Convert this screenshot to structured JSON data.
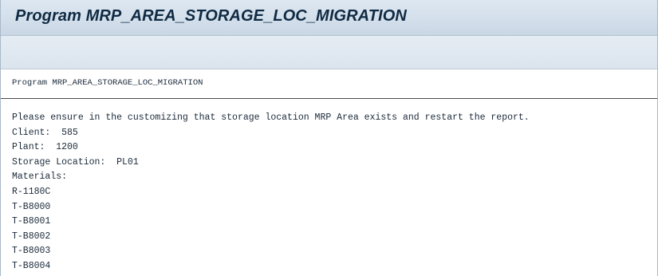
{
  "window": {
    "title": "Program MRP_AREA_STORAGE_LOC_MIGRATION"
  },
  "list": {
    "header": "Program MRP_AREA_STORAGE_LOC_MIGRATION",
    "message": "Please ensure in the customizing that storage location MRP Area exists and restart the report.",
    "client_line": "Client:  585",
    "plant_line": "Plant:  1200",
    "storage_location_line": "Storage Location:  PL01",
    "materials_label": "Materials:",
    "materials": [
      "R-1180C",
      "T-B8000",
      "T-B8001",
      "T-B8002",
      "T-B8003",
      "T-B8004"
    ]
  }
}
